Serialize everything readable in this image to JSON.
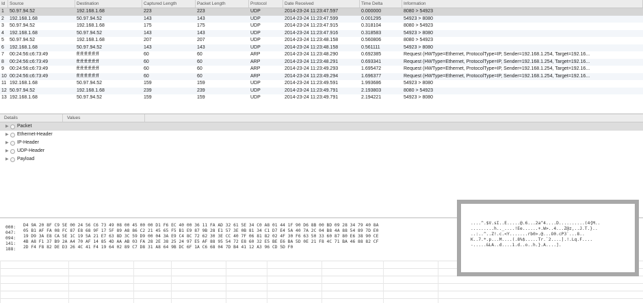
{
  "packet_table": {
    "columns": [
      "Id",
      "Source",
      "Destination",
      "Captured Length",
      "Packet Length",
      "Protocol",
      "Date Received",
      "Time Delta",
      "Information"
    ],
    "rows": [
      {
        "id": "1",
        "src": "50.97.94.52",
        "dst": "192.168.1.68",
        "cap": "223",
        "len": "223",
        "proto": "UDP",
        "date": "2014-23-24 11:23:47.597",
        "delta": "0.000000",
        "info": "8080 > 54923",
        "selected": true
      },
      {
        "id": "2",
        "src": "192.168.1.68",
        "dst": "50.97.94.52",
        "cap": "143",
        "len": "143",
        "proto": "UDP",
        "date": "2014-23-24 11:23:47.599",
        "delta": "0.001295",
        "info": "54923 > 8080"
      },
      {
        "id": "3",
        "src": "50.97.94.52",
        "dst": "192.168.1.68",
        "cap": "175",
        "len": "175",
        "proto": "UDP",
        "date": "2014-23-24 11:23:47.915",
        "delta": "0.318104",
        "info": "8080 > 54923"
      },
      {
        "id": "4",
        "src": "192.168.1.68",
        "dst": "50.97.94.52",
        "cap": "143",
        "len": "143",
        "proto": "UDP",
        "date": "2014-23-24 11:23:47.916",
        "delta": "0.318583",
        "info": "54923 > 8080"
      },
      {
        "id": "5",
        "src": "50.97.94.52",
        "dst": "192.168.1.68",
        "cap": "207",
        "len": "207",
        "proto": "UDP",
        "date": "2014-23-24 11:23:48.158",
        "delta": "0.560806",
        "info": "8080 > 54923"
      },
      {
        "id": "6",
        "src": "192.168.1.68",
        "dst": "50.97.94.52",
        "cap": "143",
        "len": "143",
        "proto": "UDP",
        "date": "2014-23-24 11:23:48.158",
        "delta": "0.561111",
        "info": "54923 > 8080"
      },
      {
        "id": "7",
        "src": "00:24:56:c6:73:49",
        "dst": "ff:ff:ff:ff:ff:ff",
        "cap": "60",
        "len": "60",
        "proto": "ARP",
        "date": "2014-23-24 11:23:48.290",
        "delta": "0.692385",
        "info": "Request (HWType=Ethernet, ProtocolType=IP, Sender=192.168.1.254, Target=192.16..."
      },
      {
        "id": "8",
        "src": "00:24:56:c6:73:49",
        "dst": "ff:ff:ff:ff:ff:ff",
        "cap": "60",
        "len": "60",
        "proto": "ARP",
        "date": "2014-23-24 11:23:48.291",
        "delta": "0.693341",
        "info": "Request (HWType=Ethernet, ProtocolType=IP, Sender=192.168.1.254, Target=192.16..."
      },
      {
        "id": "9",
        "src": "00:24:56:c6:73:49",
        "dst": "ff:ff:ff:ff:ff:ff",
        "cap": "60",
        "len": "60",
        "proto": "ARP",
        "date": "2014-23-24 11:23:49.293",
        "delta": "1.695472",
        "info": "Request (HWType=Ethernet, ProtocolType=IP, Sender=192.168.1.254, Target=192.16..."
      },
      {
        "id": "10",
        "src": "00:24:56:c6:73:49",
        "dst": "ff:ff:ff:ff:ff:ff",
        "cap": "60",
        "len": "60",
        "proto": "ARP",
        "date": "2014-23-24 11:23:49.294",
        "delta": "1.696377",
        "info": "Request (HWType=Ethernet, ProtocolType=IP, Sender=192.168.1.254, Target=192.16..."
      },
      {
        "id": "11",
        "src": "192.168.1.68",
        "dst": "50.97.94.52",
        "cap": "159",
        "len": "159",
        "proto": "UDP",
        "date": "2014-23-24 11:23:49.591",
        "delta": "1.993686",
        "info": "54923 > 8080"
      },
      {
        "id": "12",
        "src": "50.97.94.52",
        "dst": "192.168.1.68",
        "cap": "239",
        "len": "239",
        "proto": "UDP",
        "date": "2014-23-24 11:23:49.791",
        "delta": "2.193803",
        "info": "8080 > 54923"
      },
      {
        "id": "13",
        "src": "192.168.1.68",
        "dst": "50.97.94.52",
        "cap": "159",
        "len": "159",
        "proto": "UDP",
        "date": "2014-23-24 11:23:49.791",
        "delta": "2.194221",
        "info": "54923 > 8080"
      }
    ]
  },
  "details": {
    "columns": [
      "Details",
      "Values"
    ],
    "items": [
      "Packet",
      "Ethernet-Header",
      "IP-Header",
      "UDP-Header",
      "Payload"
    ]
  },
  "hex_dump": {
    "lines": [
      {
        "offset": "000:",
        "hex": "D4 9A 20 8F C9 5E 00 24 56 C6 73 49 08 00 45 00 00 D1 F6 EC 40 00 36 11 FA AD 32 61 5E 34 C0 A8 01 44 1F 90 D6 8B 00 BD 09 28 34 79 40 8A",
        "ascii": "....^.$V.sI..E.....@.6...2a^4....D..........(4{M.."
      },
      {
        "offset": "047:",
        "hex": "05 B1 AF FA 08 FC 87 E8 68 9F 17 5F 89 A8 86 C2 21 45 65 F5 B1 E9 87 9B 28 E1 57 3E 0B 81 34 C1 D7 E4 5A 40 7A 2C 04 B8 4A 88 54 89 7D E0",
        "ascii": ".........h.._....!Ee......+.W>..4...Z@z,..J.T.}.."
      },
      {
        "offset": "094:",
        "hex": "19 D9 3A E8 CA 5E 1C 19 5A 21 E7 63 8D 3C 59 D9 00 04 3A E9 C4 8C 72 62 30 3E CC 40 7F 06 81 82 02 4F 30 F6 63 50 33 60 87 80 E6 38 90 CE",
        "ascii": "..:..^..Z!.c.<Y.......rb0>.@...O0.cP3`...8.."
      },
      {
        "offset": "141:",
        "hex": "4B A8 F1 37 B9 2A A4 70 AF 14 85 4D AA AB 03 FA 28 2E 38 25 24 97 E5 AF 88 95 54 72 E8 60 32 E5 BE E6 BA 5D 0E 21 F8 4C 71 BA 46 88 82 CF",
        "ascii": "K..7.*.p...M....(.8%$.....Tr.`2....].!.Lq.F...."
      },
      {
        "offset": "188:",
        "hex": "2D F4 F8 82 DE D3 26 4C 41 F4 19 64 02 89 C7 D8 31 A8 64 9B DC 6F 1A C6 68 04 7D B4 41 12 A3 96 CD 5D F0",
        "ascii": "-.....&LA..d....1.d..o..h.}.A....]."
      }
    ]
  }
}
